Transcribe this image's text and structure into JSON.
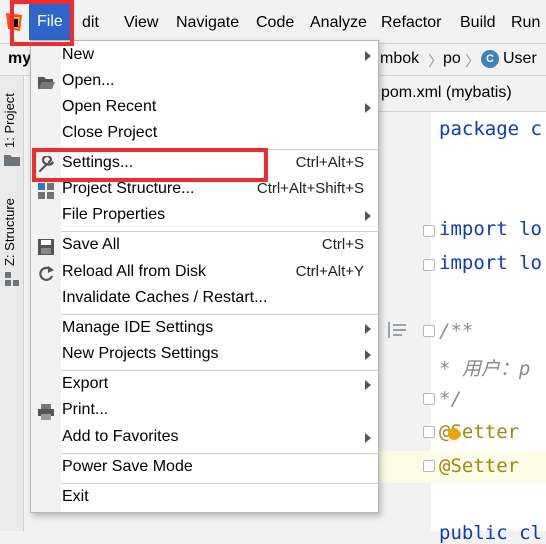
{
  "menubar": {
    "file": "File",
    "edit_rest": "dit",
    "view": "View",
    "navigate": "Navigate",
    "code": "Code",
    "analyze": "Analyze",
    "refactor": "Refactor",
    "build": "Build",
    "run": "Run"
  },
  "navbar": {
    "project_fragment": "my",
    "crumb_lombok": "mbok",
    "crumb_po": "po",
    "class_icon_letter": "C",
    "crumb_user": "User"
  },
  "toolwindows": {
    "project": "1: Project",
    "structure": "Z: Structure"
  },
  "editor": {
    "tab": "pom.xml (mybatis)",
    "line_package": "package c",
    "line_import1": "import lo",
    "line_import2": "import lo",
    "line_doc_open": "/**",
    "line_doc_body": " * 用户：p",
    "line_doc_close": " */",
    "line_setter1": "@Setter",
    "line_setter2": "@Setter",
    "line_last": "public cl"
  },
  "menu": {
    "new": "New",
    "open": "Open...",
    "open_recent": "Open Recent",
    "close_project": "Close Project",
    "settings": "Settings...",
    "settings_sc": "Ctrl+Alt+S",
    "project_structure": "Project Structure...",
    "project_structure_sc": "Ctrl+Alt+Shift+S",
    "file_properties": "File Properties",
    "save_all": "Save All",
    "save_all_sc": "Ctrl+S",
    "reload_all": "Reload All from Disk",
    "reload_all_sc": "Ctrl+Alt+Y",
    "invalidate": "Invalidate Caches / Restart...",
    "manage_ide": "Manage IDE Settings",
    "new_projects_settings": "New Projects Settings",
    "export": "Export",
    "print": "Print...",
    "add_favorites": "Add to Favorites",
    "power_save": "Power Save Mode",
    "exit": "Exit"
  },
  "colors": {
    "accent": "#2f65ca",
    "highlight_red": "#ef2b2b",
    "keyword": "#0b3cba"
  }
}
